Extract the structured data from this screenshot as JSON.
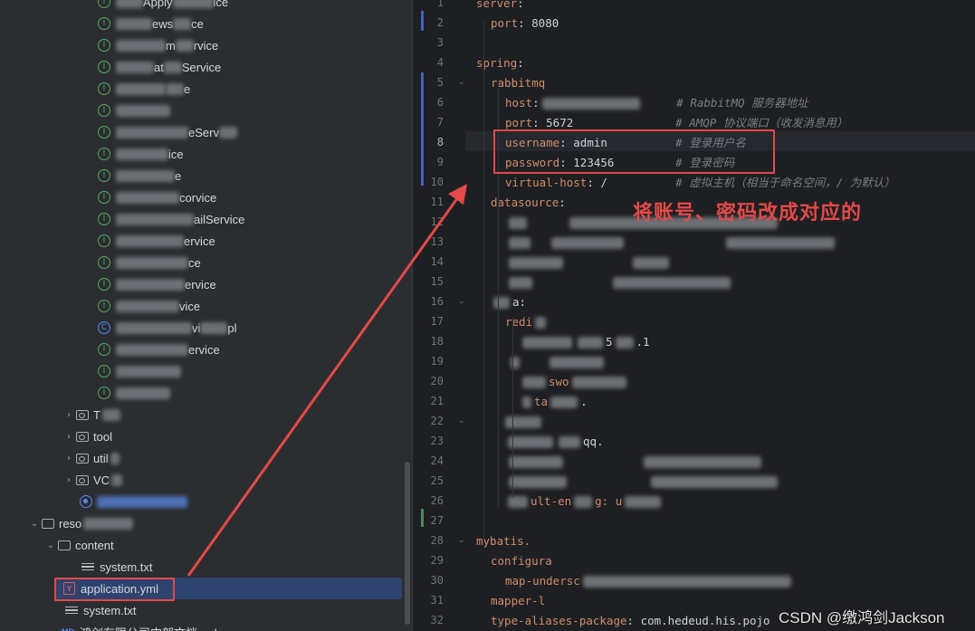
{
  "tree": {
    "service_items": [
      {
        "icon": "interface",
        "text": "Apply",
        "suffix": "ice"
      },
      {
        "icon": "interface",
        "text": "ews",
        "suffix": "ce"
      },
      {
        "icon": "interface",
        "text": "m",
        "suffix": "rvice"
      },
      {
        "icon": "interface",
        "text": "at",
        "suffix": "Service"
      },
      {
        "icon": "interface",
        "text": "",
        "suffix": "e"
      },
      {
        "icon": "interface",
        "text": "",
        "suffix": ""
      },
      {
        "icon": "interface",
        "text": "eServ",
        "suffix": ""
      },
      {
        "icon": "interface",
        "text": "",
        "suffix": "ice"
      },
      {
        "icon": "interface",
        "text": "",
        "suffix": "e"
      },
      {
        "icon": "interface",
        "text": "co",
        "suffix": "rvice"
      },
      {
        "icon": "interface",
        "text": "",
        "suffix": "ailService"
      },
      {
        "icon": "interface",
        "text": "",
        "suffix": "ervice"
      },
      {
        "icon": "interface",
        "text": "",
        "suffix": "ce"
      },
      {
        "icon": "interface",
        "text": "",
        "suffix": "ervice"
      },
      {
        "icon": "interface",
        "text": "",
        "suffix": "vice"
      },
      {
        "icon": "class",
        "text": "vi",
        "suffix": "pl"
      },
      {
        "icon": "interface",
        "text": "",
        "suffix": "ervice"
      },
      {
        "icon": "interface",
        "text": "",
        "suffix": ""
      },
      {
        "icon": "interface",
        "text": "",
        "suffix": ""
      }
    ],
    "folders": [
      {
        "label": "T"
      },
      {
        "label": "tool"
      },
      {
        "label": "util"
      },
      {
        "label": "VC"
      }
    ],
    "resources_label": "reso",
    "content_label": "content",
    "content_file": "system.txt",
    "selected_file": "application.yml",
    "sibling_file": "system.txt",
    "md_badge": "MD",
    "md_file": "鸿剑有限公司内部文档.md"
  },
  "editor": {
    "line_numbers": [
      "1",
      "2",
      "3",
      "4",
      "5",
      "6",
      "7",
      "8",
      "9",
      "10",
      "11",
      "12",
      "13",
      "14",
      "15",
      "16",
      "17",
      "18",
      "19",
      "20",
      "21",
      "22",
      "23",
      "24",
      "25",
      "26",
      "27",
      "28",
      "29",
      "30",
      "31",
      "32"
    ],
    "current_line": "8",
    "lines": {
      "l1": {
        "key": "server",
        "rest": ":"
      },
      "l2": {
        "key": "port",
        "rest": ": 8080"
      },
      "l4": {
        "key": "spring",
        "rest": ":"
      },
      "l5": {
        "key": "rabbitmq",
        "rest": ""
      },
      "l6": {
        "key": "host",
        "rest": ":",
        "comment": "# RabbitMQ 服务器地址"
      },
      "l7": {
        "key": "port",
        "rest": ": 5672",
        "comment": "# AMQP 协议端口（收发消息用）"
      },
      "l8": {
        "key": "username",
        "rest": ": admin",
        "comment": "# 登录用户名"
      },
      "l9": {
        "key": "password",
        "rest": ": 123456",
        "comment": "# 登录密码"
      },
      "l10": {
        "key": "virtual-host",
        "rest": ": /",
        "comment": "# 虚拟主机（相当于命名空间，/ 为默认）"
      },
      "l11": {
        "key": "datasource",
        "rest": ":"
      },
      "l16": {
        "key": "",
        "tail": "a:"
      },
      "l17": {
        "key": "redi",
        "rest": ""
      },
      "l18": {
        "tail": "5",
        "tail2": ".1"
      },
      "l20": {
        "tail": "swo"
      },
      "l21": {
        "tail": "ta",
        "tail2": "."
      },
      "l23": {
        "tail": "qq."
      },
      "l26": {
        "tail": "ult-en",
        "tail2": "g: u"
      },
      "l28": {
        "key": "mybatis.",
        "rest": ""
      },
      "l29": {
        "key": "configura",
        "rest": ""
      },
      "l30": {
        "key": "map-undersc",
        "rest": ""
      },
      "l31": {
        "key": "mapper-l",
        "rest": ""
      },
      "l32": {
        "key": "type-aliases-package",
        "rest": ": com.hedeud.his.pojo"
      }
    }
  },
  "annotation": {
    "note": "将账号、密码改成对应的"
  },
  "watermark": "CSDN @缴鸿剑Jackson",
  "colors": {
    "annotation_red": "#e34a4a",
    "keyword": "#cf8e6d",
    "comment": "#7a7e85",
    "selection": "#2e436e",
    "interface_icon": "#59a869",
    "class_icon": "#548af7"
  }
}
